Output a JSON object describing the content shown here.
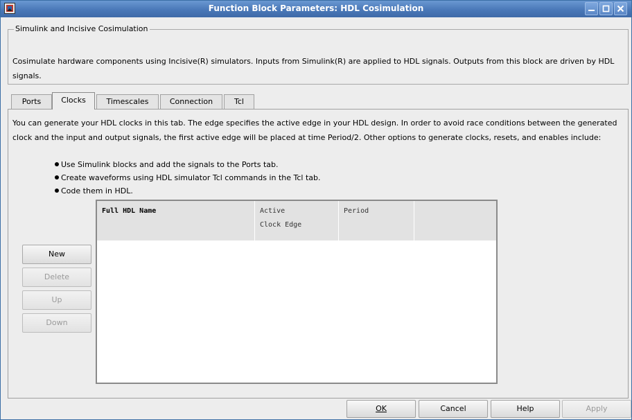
{
  "window": {
    "title": "Function Block Parameters: HDL Cosimulation",
    "icon": "simulink-block-icon",
    "controls": [
      "minimize-icon",
      "maximize-icon",
      "close-icon"
    ]
  },
  "group": {
    "legend": "Simulink and Incisive Cosimulation",
    "description": "Cosimulate hardware components using Incisive(R) simulators.  Inputs from Simulink(R) are applied to HDL signals.  Outputs from this block are driven by HDL signals."
  },
  "tabs": [
    {
      "label": "Ports"
    },
    {
      "label": "Clocks"
    },
    {
      "label": "Timescales"
    },
    {
      "label": "Connection"
    },
    {
      "label": "Tcl"
    }
  ],
  "active_tab": "Clocks",
  "clocks": {
    "intro": "You can generate your HDL clocks in this tab. The edge specifies the active edge in your HDL design. In order to avoid race conditions between the generated clock and the input and output signals, the first active edge will be placed at time Period/2. Other options to generate clocks, resets, and enables include:",
    "bullets": [
      "Use Simulink blocks and add the signals to the Ports tab.",
      "Create waveforms using HDL simulator Tcl commands in the Tcl tab.",
      "Code them in HDL."
    ],
    "buttons": {
      "new": "New",
      "delete": "Delete",
      "up": "Up",
      "down": "Down"
    },
    "table": {
      "columns": [
        {
          "line1": "Full HDL Name",
          "line2": ""
        },
        {
          "line1": "Active",
          "line2": "Clock Edge"
        },
        {
          "line1": "Period",
          "line2": ""
        },
        {
          "line1": "",
          "line2": ""
        }
      ],
      "rows": []
    }
  },
  "footer": {
    "ok": "OK",
    "cancel": "Cancel",
    "help": "Help",
    "apply": "Apply"
  }
}
